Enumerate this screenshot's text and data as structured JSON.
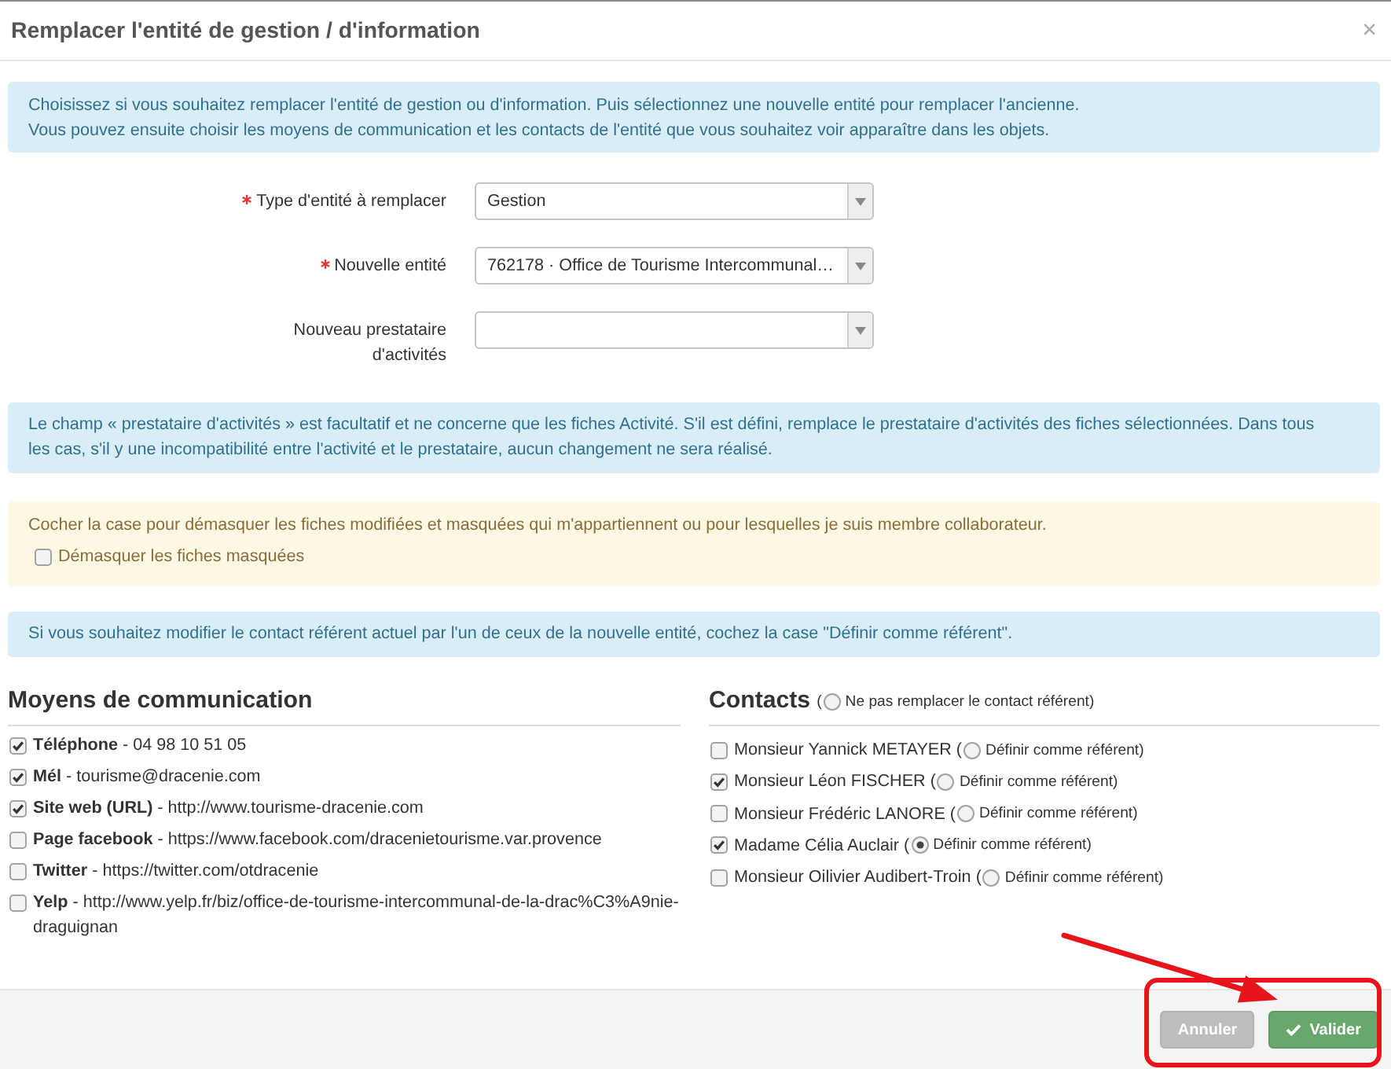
{
  "dialog": {
    "title": "Remplacer l'entité de gestion / d'information",
    "close": "×"
  },
  "intro_alert": {
    "lines": [
      "Choisissez si vous souhaitez remplacer l'entité de gestion ou d'information. Puis sélectionnez une nouvelle entité pour remplacer l'ancienne.",
      "Vous pouvez ensuite choisir les moyens de communication et les contacts de l'entité que vous souhaitez voir apparaître dans les objets."
    ]
  },
  "form": {
    "fields": [
      {
        "label": "Type d'entité à remplacer",
        "required": true,
        "value": "Gestion"
      },
      {
        "label": "Nouvelle entité",
        "required": true,
        "value": "762178 · Office de Tourisme Intercommunal…"
      },
      {
        "label": "Nouveau prestataire d'activités",
        "required": false
      }
    ]
  },
  "provider_alert": {
    "text": "Le champ « prestataire d'activités » est facultatif et ne concerne que les fiches Activité. S'il est défini, remplace le prestataire d'activités des fiches sélectionnées. Dans tous les cas, s'il y une incompatibilité entre l'activité et le prestataire, aucun changement ne sera réalisé."
  },
  "unmask_warning": {
    "text": "Cocher la case pour démasquer les fiches modifiées et masquées qui m'appartiennent ou pour lesquelles je suis membre collaborateur.",
    "checkbox": {
      "label": "Démasquer les fiches masquées",
      "checked": false
    }
  },
  "referent_alert": {
    "text": "Si vous souhaitez modifier le contact référent actuel par l'un de ceux de la nouvelle entité, cochez la case \"Définir comme référent\"."
  },
  "communication": {
    "heading": "Moyens de communication",
    "items": [
      {
        "text": "**Téléphone** - 04 98 10 51 05",
        "checked": true
      },
      {
        "text": "**Mél** - tourisme@dracenie.com",
        "checked": true
      },
      {
        "text": "**Site web (URL)** - http://www.tourisme-dracenie.com",
        "checked": true
      },
      {
        "text": "**Page facebook** - https://www.facebook.com/dracenietourisme.var.provence",
        "checked": false
      },
      {
        "text": "**Twitter** - https://twitter.com/otdracenie",
        "checked": false
      },
      {
        "text": "**Yelp** - http://www.yelp.fr/biz/office-de-tourisme-intercommunal-de-la-drac%C3%A9nie-draguignan",
        "checked": false
      }
    ]
  },
  "contacts": {
    "heading": "Contacts",
    "keep_referent": {
      "open": "(",
      "label": "Ne pas remplacer le contact référent)",
      "selected": false
    },
    "items": [
      {
        "name": "Monsieur Yannick METAYER",
        "checked": false,
        "referent": {
          "open": "(",
          "label": "Définir comme référent)",
          "selected": false
        }
      },
      {
        "name": "Monsieur Léon FISCHER",
        "checked": true,
        "referent": {
          "open": "(",
          "label": "Définir comme référent)",
          "selected": false
        }
      },
      {
        "name": "Monsieur Frédéric LANORE",
        "checked": false,
        "referent": {
          "open": "(",
          "label": "Définir comme référent)",
          "selected": false
        }
      },
      {
        "name": "Madame Célia Auclair",
        "checked": true,
        "referent": {
          "open": "(",
          "label": "Définir comme référent)",
          "selected": true
        }
      },
      {
        "name": "Monsieur Oilivier Audibert-Troin",
        "checked": false,
        "referent": {
          "open": "(",
          "label": "Définir comme référent)",
          "selected": false
        }
      }
    ]
  },
  "footer": {
    "buttons": [
      {
        "label": "Annuler",
        "kind": "secondary"
      },
      {
        "label": "Valider",
        "kind": "primary"
      }
    ]
  }
}
